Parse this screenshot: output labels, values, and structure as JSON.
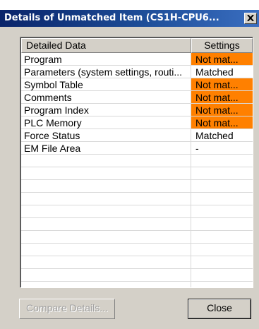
{
  "dialog": {
    "title": "Details of Unmatched Item (CS1H-CPU6...",
    "close_glyph": "X"
  },
  "table": {
    "columns": [
      "Detailed Data",
      "Settings"
    ],
    "rows": [
      {
        "name": "Program",
        "status": "Not mat...",
        "mismatch": true
      },
      {
        "name": "Parameters (system settings, routi...",
        "status": "Matched",
        "mismatch": false
      },
      {
        "name": "Symbol Table",
        "status": "Not mat...",
        "mismatch": true
      },
      {
        "name": "Comments",
        "status": "Not mat...",
        "mismatch": true
      },
      {
        "name": "Program Index",
        "status": "Not mat...",
        "mismatch": true
      },
      {
        "name": "PLC Memory",
        "status": "Not mat...",
        "mismatch": true
      },
      {
        "name": "Force Status",
        "status": "Matched",
        "mismatch": false
      },
      {
        "name": "EM File Area",
        "status": "-",
        "mismatch": false
      },
      {
        "name": "",
        "status": "",
        "mismatch": false
      },
      {
        "name": "",
        "status": "",
        "mismatch": false
      },
      {
        "name": "",
        "status": "",
        "mismatch": false
      },
      {
        "name": "",
        "status": "",
        "mismatch": false
      },
      {
        "name": "",
        "status": "",
        "mismatch": false
      },
      {
        "name": "",
        "status": "",
        "mismatch": false
      },
      {
        "name": "",
        "status": "",
        "mismatch": false
      },
      {
        "name": "",
        "status": "",
        "mismatch": false
      },
      {
        "name": "",
        "status": "",
        "mismatch": false
      },
      {
        "name": "",
        "status": "",
        "mismatch": false
      },
      {
        "name": "",
        "status": "",
        "mismatch": false
      }
    ]
  },
  "buttons": {
    "compare_label": "Compare Details...",
    "compare_enabled": false,
    "close_label": "Close"
  },
  "colors": {
    "title_bar": "#0a246a",
    "mismatch": "#ff8000",
    "dialog_face": "#d4d0c8"
  }
}
